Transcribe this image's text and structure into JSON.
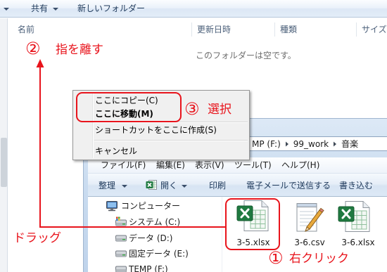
{
  "back_window": {
    "toolbar": {
      "share_label": "共有",
      "new_folder_label": "新しいフォルダー"
    },
    "columns": {
      "name": "名前",
      "modified": "更新日時",
      "type": "種類",
      "size": "サイズ"
    },
    "empty_message": "このフォルダーは空です。"
  },
  "context_menu": {
    "items": [
      {
        "label": "ここにコピー(C)",
        "bold": false
      },
      {
        "label": "ここに移動(M)",
        "bold": true
      },
      {
        "label": "ショートカットをここに作成(S)",
        "bold": false
      },
      {
        "label": "キャンセル",
        "bold": false
      }
    ]
  },
  "front_window": {
    "address": {
      "crumbs": [
        "MP (F:)",
        "99_work",
        "音楽"
      ]
    },
    "menu_bar": {
      "items": [
        "ファイル(F)",
        "編集(E)",
        "表示(V)",
        "ツール(T)",
        "ヘルプ(H)"
      ]
    },
    "toolbar": {
      "organize": "整理",
      "open": "開く",
      "print": "印刷",
      "email": "電子メールで送信する",
      "burn": "書き込む"
    },
    "nav": [
      {
        "label": "コンピューター",
        "icon": "computer-icon"
      },
      {
        "label": "システム (C:)",
        "icon": "system-drive-icon"
      },
      {
        "label": "データ (D:)",
        "icon": "drive-icon"
      },
      {
        "label": "固定データ (E:)",
        "icon": "drive-icon"
      },
      {
        "label": "TEMP (F:)",
        "icon": "drive-icon"
      }
    ],
    "files": [
      {
        "name": "3-5.xlsx",
        "icon": "excel-file-icon",
        "highlighted": true
      },
      {
        "name": "3-6.csv",
        "icon": "notepad-file-icon",
        "highlighted": false
      },
      {
        "name": "3-6.xlsx",
        "icon": "excel-file-icon",
        "highlighted": false
      }
    ]
  },
  "annotations": {
    "step1": {
      "number": "①",
      "text": "右クリック"
    },
    "step2": {
      "number": "②",
      "text": "指を離す"
    },
    "step3": {
      "number": "③",
      "text": "選択"
    },
    "drag": "ドラッグ"
  },
  "colors": {
    "annotation_red": "#e8141c",
    "excel_green": "#1f7a40",
    "toolbar_text": "#1e395b"
  }
}
